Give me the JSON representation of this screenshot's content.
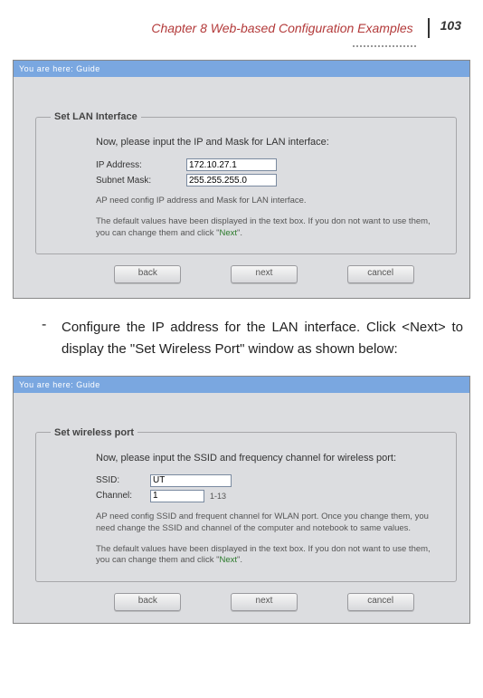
{
  "header": {
    "chapter": "Chapter 8 Web-based Configuration Examples",
    "page_number": "103"
  },
  "screenshot1": {
    "titlebar": "You are here: Guide",
    "legend": "Set LAN Interface",
    "intro": "Now, please input the IP and Mask for LAN interface:",
    "ip_label": "IP Address:",
    "ip_value": "172.10.27.1",
    "mask_label": "Subnet Mask:",
    "mask_value": "255.255.255.0",
    "note1": "AP need config IP address and Mask for LAN interface.",
    "note2_a": "The default values have been displayed in the text box. If you don not want to use them, you can change them and click \"",
    "note2_b": "Next",
    "note2_c": "\".",
    "btn_back": "back",
    "btn_next": "next",
    "btn_cancel": "cancel"
  },
  "body": {
    "para": "Configure the IP address for the LAN interface. Click <Next> to display the \"Set Wireless Port\" window as shown below:",
    "dash": "-"
  },
  "screenshot2": {
    "titlebar": "You are here: Guide",
    "legend": "Set wireless port",
    "intro": "Now, please input the SSID and frequency channel for wireless port:",
    "ssid_label": "SSID:",
    "ssid_value": "UT",
    "channel_label": "Channel:",
    "channel_value": "1",
    "channel_after": "1-13",
    "note1": "AP need config SSID and frequent channel for WLAN port. Once you change them, you need change the SSID and channel of the computer and notebook to same values.",
    "note2_a": "The default values have been displayed in the text box. If you don not want to use them, you can change them and click \"",
    "note2_b": "Next",
    "note2_c": "\".",
    "btn_back": "back",
    "btn_next": "next",
    "btn_cancel": "cancel"
  }
}
